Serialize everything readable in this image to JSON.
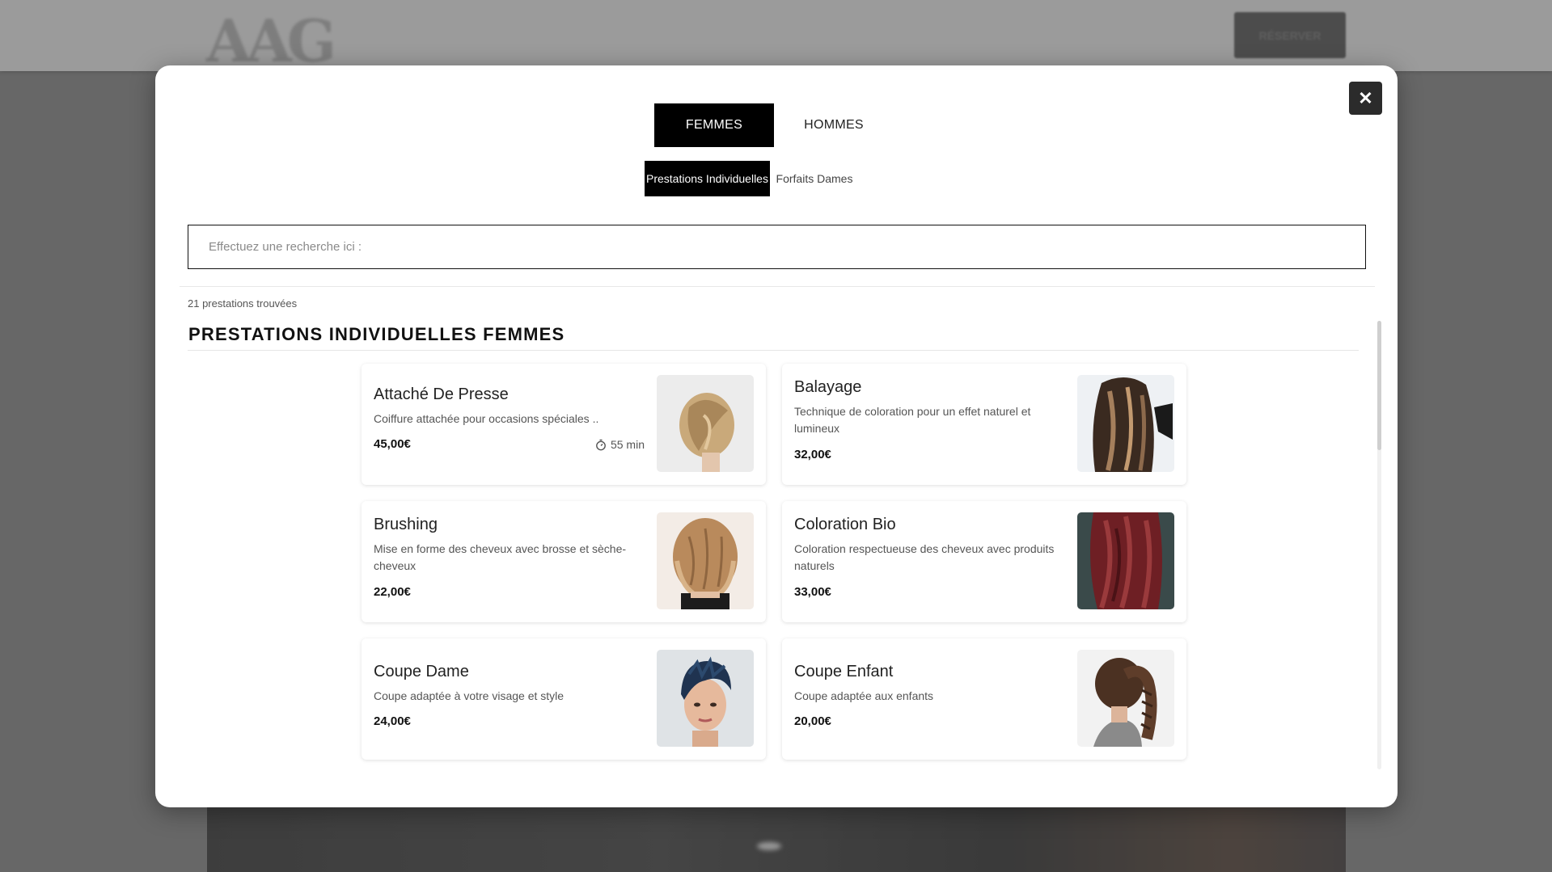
{
  "background": {
    "logo": "AAG",
    "cta_label": "RÉSERVER"
  },
  "modal": {
    "close_symbol": "✕",
    "gender_tabs": [
      {
        "label": "FEMMES",
        "active": true
      },
      {
        "label": "HOMMES",
        "active": false
      }
    ],
    "category_tabs": [
      {
        "label": "Prestations Individuelles",
        "active": true
      },
      {
        "label": "Forfaits Dames",
        "active": false
      }
    ],
    "search": {
      "placeholder": "Effectuez une recherche ici :",
      "value": ""
    },
    "result_count": "21 prestations trouvées",
    "section_title": "PRESTATIONS INDIVIDUELLES FEMMES",
    "services": [
      {
        "name": "Attaché De Presse",
        "description": "Coiffure attachée pour occasions spéciales ..",
        "price": "45,00€",
        "duration": "55 min",
        "image_icon": "updo-hair-photo",
        "accent": "#c9a97a"
      },
      {
        "name": "Balayage",
        "description": "Technique de coloration pour un effet naturel et lumineux",
        "price": "32,00€",
        "image_icon": "balayage-hair-photo",
        "accent": "#4a3426"
      },
      {
        "name": "Brushing",
        "description": "Mise en forme des cheveux avec brosse et sèche-cheveux",
        "price": "22,00€",
        "image_icon": "blowdry-hair-photo",
        "accent": "#b98a5c"
      },
      {
        "name": "Coloration Bio",
        "description": "Coloration respectueuse des cheveux avec produits naturels",
        "price": "33,00€",
        "image_icon": "red-hair-photo",
        "accent": "#6e1f24"
      },
      {
        "name": "Coupe Dame",
        "description": "Coupe adaptée à votre visage et style",
        "price": "24,00€",
        "image_icon": "pixie-cut-photo",
        "accent": "#1f3350"
      },
      {
        "name": "Coupe Enfant",
        "description": "Coupe adaptée aux enfants",
        "price": "20,00€",
        "image_icon": "braided-ponytail-photo",
        "accent": "#4b3122"
      }
    ]
  }
}
